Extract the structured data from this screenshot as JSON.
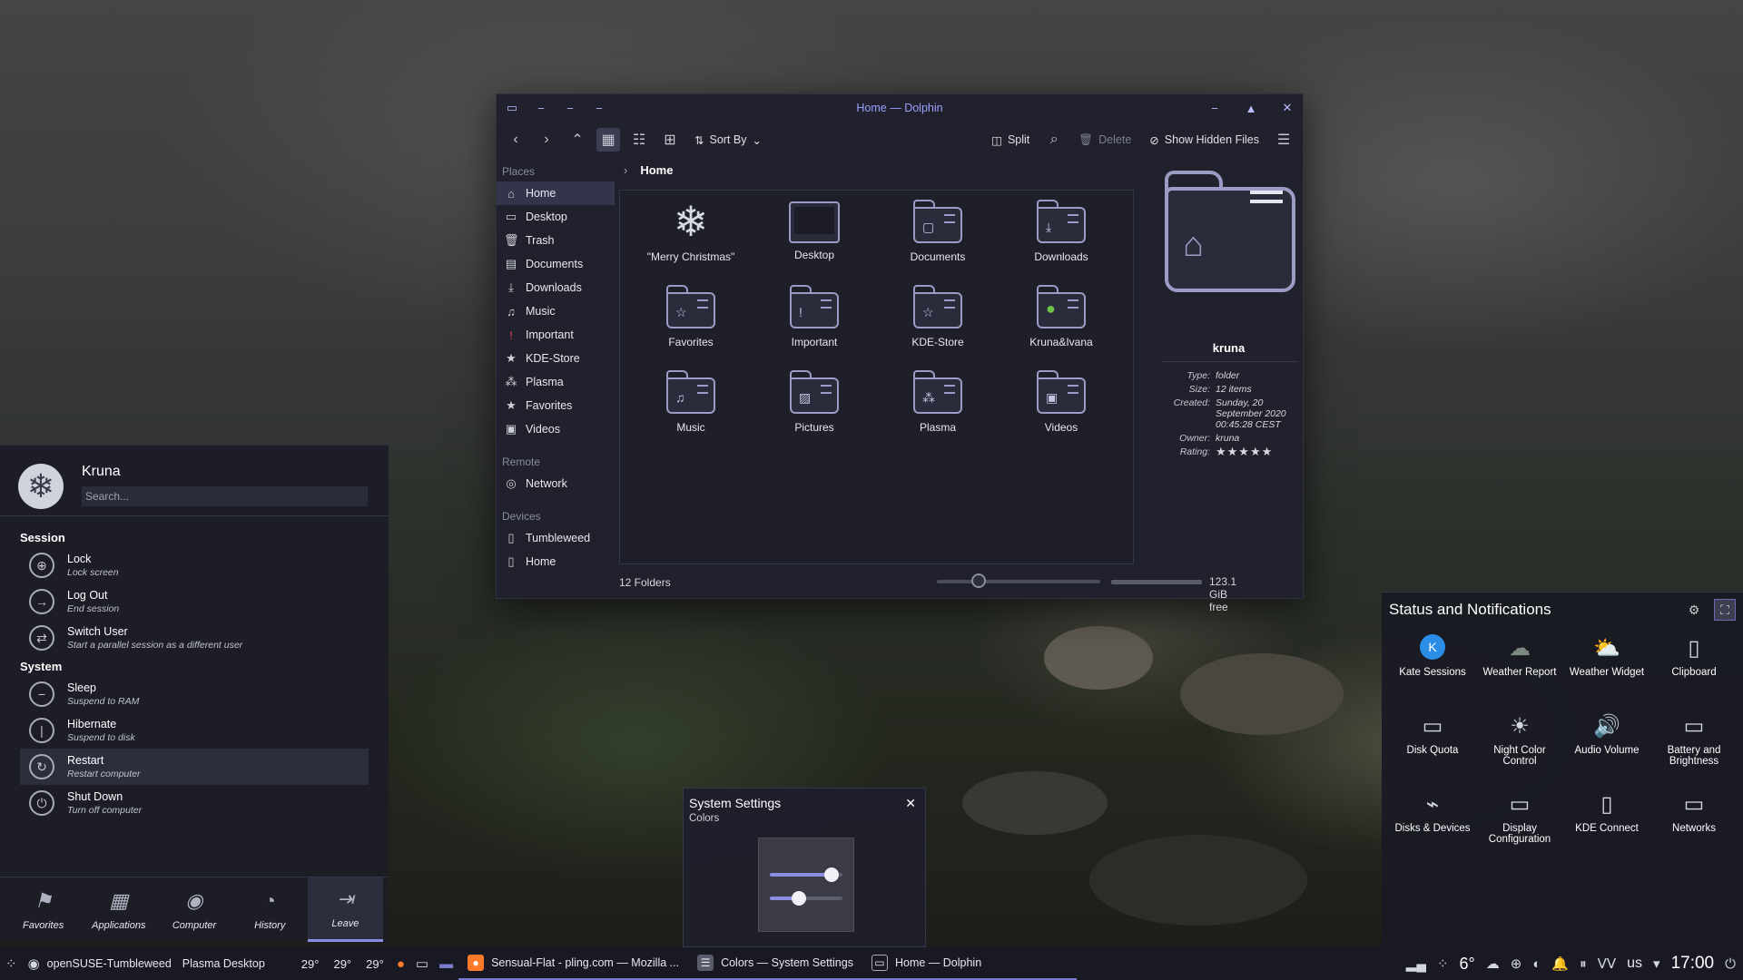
{
  "dolphin": {
    "title": "Home — Dolphin",
    "toolbar": {
      "sort_by": "Sort By",
      "split": "Split",
      "delete": "Delete",
      "show_hidden": "Show Hidden Files"
    },
    "places": {
      "places_label": "Places",
      "items": [
        "Home",
        "Desktop",
        "Trash",
        "Documents",
        "Downloads",
        "Music",
        "Important",
        "KDE-Store",
        "Plasma",
        "Favorites",
        "Videos"
      ],
      "remote_label": "Remote",
      "remote_items": [
        "Network"
      ],
      "devices_label": "Devices",
      "device_items": [
        "Tumbleweed",
        "Home"
      ]
    },
    "breadcrumb": "Home",
    "files": [
      "\"Merry Christmas\"",
      "Desktop",
      "Documents",
      "Downloads",
      "Favorites",
      "Important",
      "KDE-Store",
      "Kruna&Ivana",
      "Music",
      "Pictures",
      "Plasma",
      "Videos"
    ],
    "status": {
      "count": "12 Folders",
      "free": "123.1 GiB free"
    },
    "info": {
      "name": "kruna",
      "type_k": "Type:",
      "type_v": "folder",
      "size_k": "Size:",
      "size_v": "12 items",
      "created_k": "Created:",
      "created_v": "Sunday, 20 September 2020 00:45:28 CEST",
      "owner_k": "Owner:",
      "owner_v": "kruna",
      "rating_k": "Rating:",
      "rating_v": "★★★★★"
    }
  },
  "launcher": {
    "user": "Kruna",
    "search_placeholder": "Search...",
    "session_label": "Session",
    "session": [
      {
        "title": "Lock",
        "sub": "Lock screen"
      },
      {
        "title": "Log Out",
        "sub": "End session"
      },
      {
        "title": "Switch User",
        "sub": "Start a parallel session as a different user"
      }
    ],
    "system_label": "System",
    "system": [
      {
        "title": "Sleep",
        "sub": "Suspend to RAM"
      },
      {
        "title": "Hibernate",
        "sub": "Suspend to disk"
      },
      {
        "title": "Restart",
        "sub": "Restart computer"
      },
      {
        "title": "Shut Down",
        "sub": "Turn off computer"
      }
    ],
    "nav": [
      "Favorites",
      "Applications",
      "Computer",
      "History",
      "Leave"
    ]
  },
  "osd": {
    "title": "System Settings",
    "subtitle": "Colors",
    "close": "✕",
    "slider1": 0.85,
    "slider2": 0.4
  },
  "status": {
    "title": "Status and Notifications",
    "items": [
      "Kate Sessions",
      "Weather Report",
      "Weather Widget",
      "Clipboard",
      "Disk Quota",
      "Night Color Control",
      "Audio Volume",
      "Battery and Brightness",
      "Disks & Devices",
      "Display Configuration",
      "KDE Connect",
      "Networks"
    ]
  },
  "taskbar": {
    "os": "openSUSE-Tumbleweed",
    "desktop": "Plasma Desktop",
    "temps": [
      "29°",
      "29°",
      "29°"
    ],
    "tasks": [
      "Sensual-Flat - pling.com — Mozilla ...",
      "Colors — System Settings",
      "Home — Dolphin"
    ],
    "weather_temp": "6°",
    "layout": "us",
    "clock": "17:00"
  }
}
